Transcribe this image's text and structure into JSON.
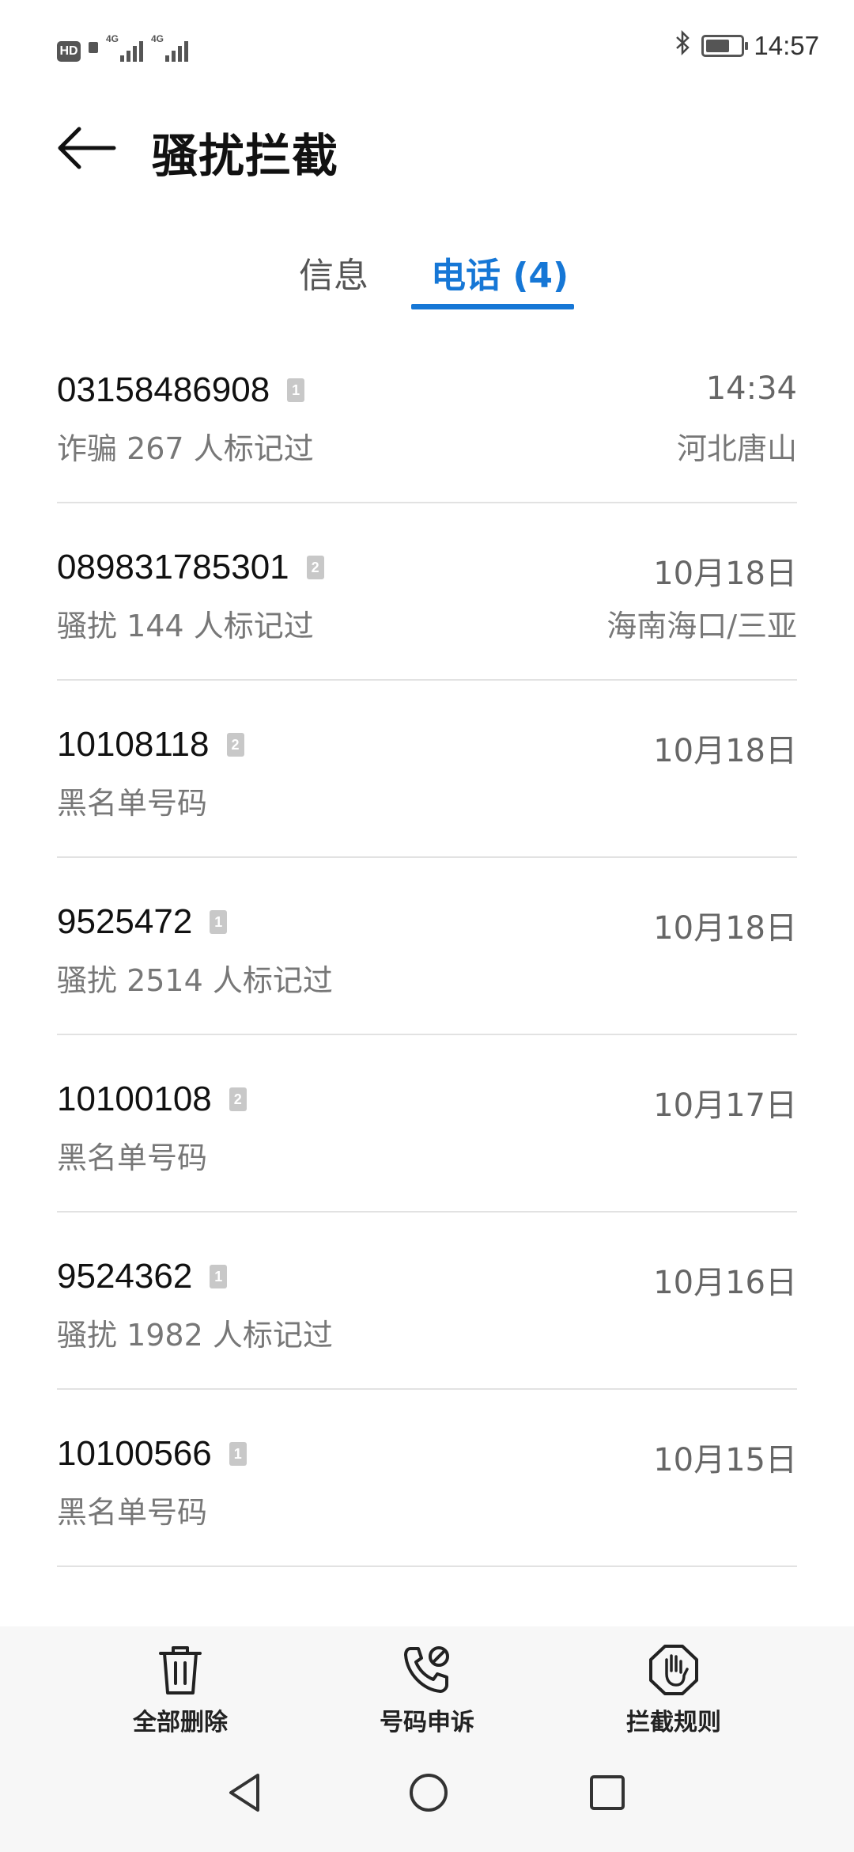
{
  "status_bar": {
    "hd_label": "HD",
    "signal1_label": "4G",
    "signal2_label": "4G",
    "time": "14:57",
    "battery_level": 0.7
  },
  "header": {
    "title": "骚扰拦截"
  },
  "tabs": [
    {
      "label": "信息",
      "selected": false
    },
    {
      "label": "电话 (4)",
      "selected": true
    }
  ],
  "calls": [
    {
      "number": "03158486908",
      "sim": "1",
      "date": "14:34",
      "tag": "诈骗  267 人标记过",
      "location": "河北唐山"
    },
    {
      "number": "089831785301",
      "sim": "2",
      "date": "10月18日",
      "tag": "骚扰  144 人标记过",
      "location": "海南海口/三亚"
    },
    {
      "number": "10108118",
      "sim": "2",
      "date": "10月18日",
      "tag": "黑名单号码",
      "location": ""
    },
    {
      "number": "9525472",
      "sim": "1",
      "date": "10月18日",
      "tag": "骚扰  2514 人标记过",
      "location": ""
    },
    {
      "number": "10100108",
      "sim": "2",
      "date": "10月17日",
      "tag": "黑名单号码",
      "location": ""
    },
    {
      "number": "9524362",
      "sim": "1",
      "date": "10月16日",
      "tag": "骚扰  1982 人标记过",
      "location": ""
    },
    {
      "number": "10100566",
      "sim": "1",
      "date": "10月15日",
      "tag": "黑名单号码",
      "location": ""
    }
  ],
  "toolbar": {
    "delete_all": "全部删除",
    "appeal": "号码申诉",
    "rules": "拦截规则"
  },
  "colors": {
    "accent": "#1677d6",
    "divider": "#e2e2e2"
  }
}
